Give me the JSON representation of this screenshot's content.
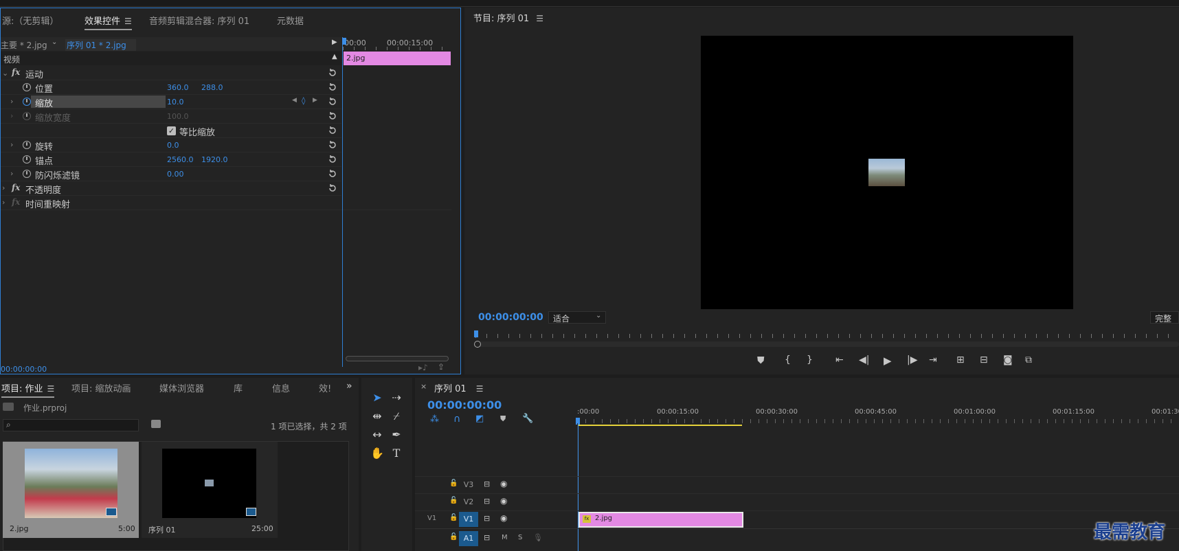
{
  "effect_panel": {
    "tabs": [
      "源:（无剪辑）",
      "效果控件",
      "音频剪辑混合器: 序列 01",
      "元数据"
    ],
    "master_clip": "主要 * 2.jpg",
    "seq_clip": "序列 01 * 2.jpg",
    "ruler_times": [
      "00:00",
      "00:00:15:00"
    ],
    "clip_label": "2.jpg",
    "section_video": "视频",
    "fx_motion": "运动",
    "props": [
      {
        "name": "位置",
        "v1": "360.0",
        "v2": "288.0"
      },
      {
        "name": "缩放",
        "v1": "10.0",
        "v2": ""
      },
      {
        "name": "缩放宽度",
        "v1": "100.0",
        "v2": ""
      },
      {
        "name": "等比缩放",
        "v1": "",
        "v2": ""
      },
      {
        "name": "旋转",
        "v1": "0.0",
        "v2": ""
      },
      {
        "name": "锚点",
        "v1": "2560.0",
        "v2": "1920.0"
      },
      {
        "name": "防闪烁滤镜",
        "v1": "0.00",
        "v2": ""
      }
    ],
    "fx_opacity": "不透明度",
    "fx_time_remap": "时间重映射",
    "timecode": "00:00:00:00"
  },
  "program_monitor": {
    "title": "节目: 序列 01",
    "timecode": "00:00:00:00",
    "fit": "适合",
    "quality": "完整"
  },
  "project_panel": {
    "tabs": [
      "项目: 作业",
      "项目: 缩放动画",
      "媒体浏览器",
      "库",
      "信息",
      "效!"
    ],
    "project_file": "作业.prproj",
    "selection_info": "1 项已选择，共 2 项",
    "items": [
      {
        "name": "2.jpg",
        "duration": "5:00"
      },
      {
        "name": "序列 01",
        "duration": "25:00"
      }
    ]
  },
  "timeline": {
    "tab": "序列 01",
    "timecode": "00:00:00:00",
    "ruler": [
      ":00:00",
      "00:00:15:00",
      "00:00:30:00",
      "00:00:45:00",
      "00:01:00:00",
      "00:01:15:00",
      "00:01:30"
    ],
    "tracks": [
      {
        "src": "",
        "name": "V3"
      },
      {
        "src": "",
        "name": "V2"
      },
      {
        "src": "V1",
        "name": "V1"
      },
      {
        "src": "",
        "name": "A1"
      }
    ],
    "clip": "2.jpg",
    "mute": "M",
    "solo": "S"
  },
  "watermark": "最需教育",
  "colors": {
    "accent": "#3d8fe8",
    "clip": "#e389e3",
    "track_on": "#1b5a8e"
  }
}
